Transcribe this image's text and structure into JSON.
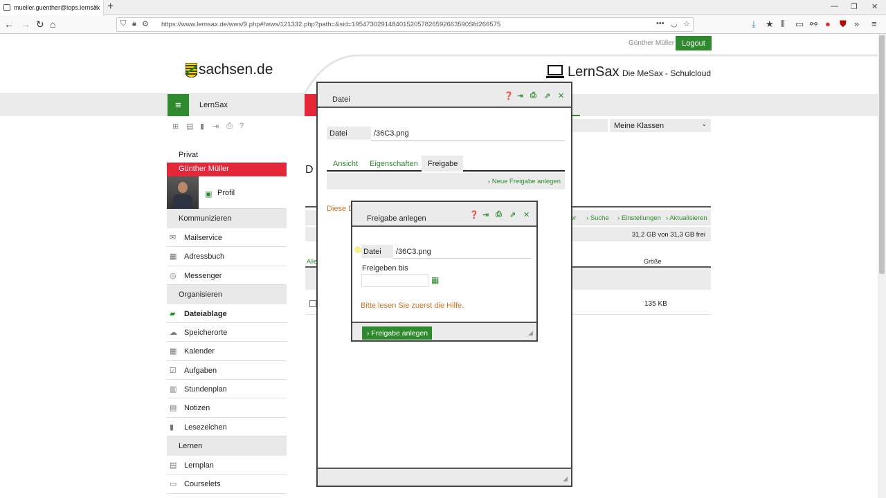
{
  "browser": {
    "tab_title": "mueller.guenther@lops.lernsax",
    "url": "https://www.lernsax.de/wws/9.php#/wws/121332.php?path=&sid=19547302914840152057826592663590Sfd266575",
    "url_domain": "lernsax.de"
  },
  "header": {
    "user_name": "Günther Müller",
    "logout_label": "Logout",
    "sachsen_logo": "sachsen.de",
    "brand_name": "LernSax",
    "brand_subtitle": "Die MeSax - Schulcloud",
    "nav_title": "LernSax",
    "class_select": "Meine Klassen"
  },
  "sidebar": {
    "private_heading": "Privat",
    "user": "Günther Müller",
    "profile_label": "Profil",
    "communicate_heading": "Kommunizieren",
    "communicate_items": [
      {
        "label": "Mailservice",
        "icon": "mail-icon"
      },
      {
        "label": "Adressbuch",
        "icon": "addressbook-icon"
      },
      {
        "label": "Messenger",
        "icon": "messenger-icon"
      }
    ],
    "organize_heading": "Organisieren",
    "organize_items": [
      {
        "label": "Dateiablage",
        "icon": "folder-icon"
      },
      {
        "label": "Speicherorte",
        "icon": "cloud-icon"
      },
      {
        "label": "Kalender",
        "icon": "calendar-icon"
      },
      {
        "label": "Aufgaben",
        "icon": "task-icon"
      },
      {
        "label": "Stundenplan",
        "icon": "timetable-icon"
      },
      {
        "label": "Notizen",
        "icon": "notes-icon"
      },
      {
        "label": "Lesezeichen",
        "icon": "bookmark-icon"
      }
    ],
    "learn_heading": "Lernen",
    "learn_items": [
      {
        "label": "Lernplan",
        "icon": "learnplan-icon"
      },
      {
        "label": "Courselets",
        "icon": "courselets-icon"
      }
    ]
  },
  "background": {
    "title_fragment": "D",
    "toolbar_links": [
      "er",
      "Suche",
      "Einstellungen",
      "Aktualisieren"
    ],
    "storage": "31,2 GB von 31,3 GB frei",
    "col_all": "Alle",
    "col_size": "Größe",
    "file_size": "135 KB"
  },
  "dialog_file": {
    "title": "Datei",
    "file_label": "Datei",
    "file_value": "/36C3.png",
    "tabs": [
      "Ansicht",
      "Eigenschaften",
      "Freigabe"
    ],
    "new_share_link": "Neue Freigabe anlegen",
    "orange_text": "Diese D"
  },
  "dialog_share": {
    "title": "Freigabe anlegen",
    "file_label": "Datei",
    "file_value": "/36C3.png",
    "until_label": "Freigeben bis",
    "date_value": "",
    "help_text": "Bitte lesen Sie zuerst die Hilfe.",
    "create_button": "Freigabe anlegen"
  },
  "colors": {
    "accent_green": "#2f8a2f",
    "accent_red": "#e4283a",
    "warning_orange": "#d0721d"
  }
}
